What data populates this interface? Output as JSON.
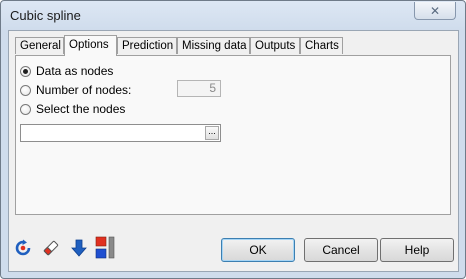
{
  "window": {
    "title": "Cubic spline",
    "close_glyph": "✕"
  },
  "tabs": [
    {
      "label": "General"
    },
    {
      "label": "Options"
    },
    {
      "label": "Prediction"
    },
    {
      "label": "Missing data"
    },
    {
      "label": "Outputs"
    },
    {
      "label": "Charts"
    }
  ],
  "active_tab": "Options",
  "options": {
    "data_as_nodes_label": "Data as nodes",
    "number_of_nodes_label": "Number of nodes:",
    "number_of_nodes_value": "5",
    "select_nodes_label": "Select the nodes",
    "range_button_label": "...",
    "selected_option": "Data as nodes"
  },
  "buttons": {
    "ok": "OK",
    "cancel": "Cancel",
    "help": "Help"
  },
  "icons": [
    "reset-icon",
    "eraser-icon",
    "down-arrow-icon",
    "color-squares-icon"
  ],
  "colors": {
    "accent": "#3c7fb1",
    "arrow_blue": "#1f5fbf",
    "red": "#e03020"
  }
}
